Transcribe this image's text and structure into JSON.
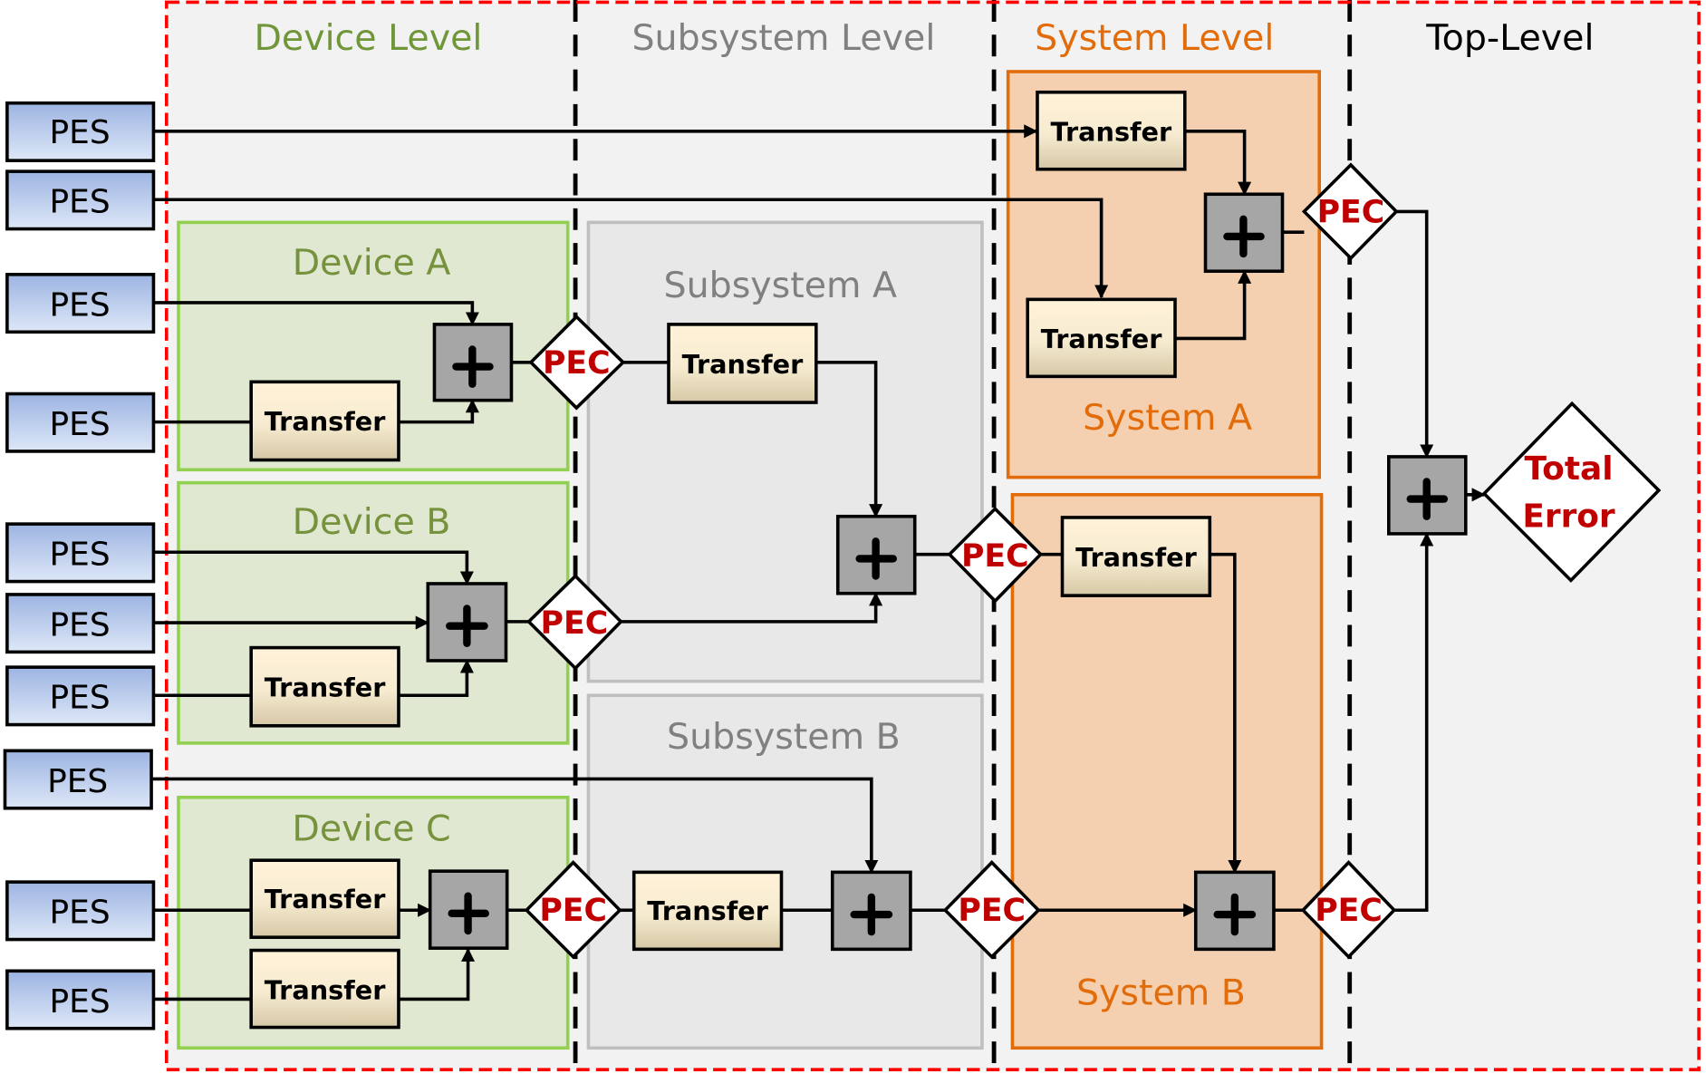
{
  "levels": [
    {
      "label": "Device Level",
      "color": "#70963a"
    },
    {
      "label": "Subsystem Level",
      "color": "#808080"
    },
    {
      "label": "System Level",
      "color": "#e36c0a"
    },
    {
      "label": "Top-Level",
      "color": "#000000"
    }
  ],
  "groups": {
    "device_a": "Device A",
    "device_b": "Device B",
    "device_c": "Device C",
    "subsystem_a": "Subsystem A",
    "subsystem_b": "Subsystem B",
    "system_a": "System A",
    "system_b": "System B"
  },
  "blocks": {
    "pes": "PES",
    "transfer": "Transfer",
    "pec": "PEC",
    "sum_symbol": "+",
    "total_error_line1": "Total",
    "total_error_line2": "Error"
  },
  "colors": {
    "outer_border": "#ff0000",
    "level_background": "#f2f2f2",
    "device_fill": "#e0e8d2",
    "device_border": "#92d050",
    "subsystem_fill": "#e8e8e8",
    "subsystem_border": "#bfbfbf",
    "system_fill": "#f4d0b0",
    "system_border": "#e36c0a",
    "pes_top": "#9db4e2",
    "pes_bottom": "#dce6f6",
    "transfer_top": "#fff2d6",
    "transfer_bottom": "#d9ccac",
    "sum_fill": "#a6a6a6",
    "pec_text": "#c00000"
  }
}
